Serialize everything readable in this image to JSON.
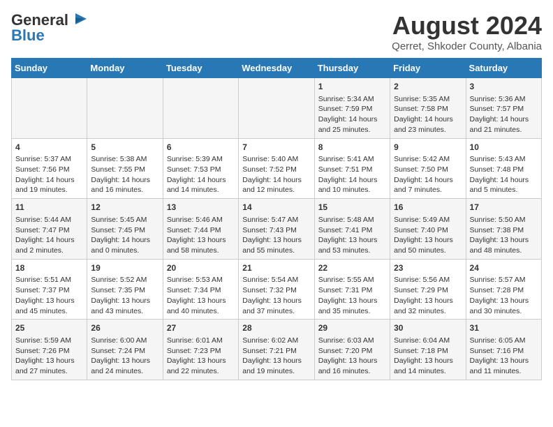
{
  "header": {
    "logo_general": "General",
    "logo_blue": "Blue",
    "month_year": "August 2024",
    "location": "Qerret, Shkoder County, Albania"
  },
  "weekdays": [
    "Sunday",
    "Monday",
    "Tuesday",
    "Wednesday",
    "Thursday",
    "Friday",
    "Saturday"
  ],
  "weeks": [
    [
      {
        "day": "",
        "info": ""
      },
      {
        "day": "",
        "info": ""
      },
      {
        "day": "",
        "info": ""
      },
      {
        "day": "",
        "info": ""
      },
      {
        "day": "1",
        "info": "Sunrise: 5:34 AM\nSunset: 7:59 PM\nDaylight: 14 hours\nand 25 minutes."
      },
      {
        "day": "2",
        "info": "Sunrise: 5:35 AM\nSunset: 7:58 PM\nDaylight: 14 hours\nand 23 minutes."
      },
      {
        "day": "3",
        "info": "Sunrise: 5:36 AM\nSunset: 7:57 PM\nDaylight: 14 hours\nand 21 minutes."
      }
    ],
    [
      {
        "day": "4",
        "info": "Sunrise: 5:37 AM\nSunset: 7:56 PM\nDaylight: 14 hours\nand 19 minutes."
      },
      {
        "day": "5",
        "info": "Sunrise: 5:38 AM\nSunset: 7:55 PM\nDaylight: 14 hours\nand 16 minutes."
      },
      {
        "day": "6",
        "info": "Sunrise: 5:39 AM\nSunset: 7:53 PM\nDaylight: 14 hours\nand 14 minutes."
      },
      {
        "day": "7",
        "info": "Sunrise: 5:40 AM\nSunset: 7:52 PM\nDaylight: 14 hours\nand 12 minutes."
      },
      {
        "day": "8",
        "info": "Sunrise: 5:41 AM\nSunset: 7:51 PM\nDaylight: 14 hours\nand 10 minutes."
      },
      {
        "day": "9",
        "info": "Sunrise: 5:42 AM\nSunset: 7:50 PM\nDaylight: 14 hours\nand 7 minutes."
      },
      {
        "day": "10",
        "info": "Sunrise: 5:43 AM\nSunset: 7:48 PM\nDaylight: 14 hours\nand 5 minutes."
      }
    ],
    [
      {
        "day": "11",
        "info": "Sunrise: 5:44 AM\nSunset: 7:47 PM\nDaylight: 14 hours\nand 2 minutes."
      },
      {
        "day": "12",
        "info": "Sunrise: 5:45 AM\nSunset: 7:45 PM\nDaylight: 14 hours\nand 0 minutes."
      },
      {
        "day": "13",
        "info": "Sunrise: 5:46 AM\nSunset: 7:44 PM\nDaylight: 13 hours\nand 58 minutes."
      },
      {
        "day": "14",
        "info": "Sunrise: 5:47 AM\nSunset: 7:43 PM\nDaylight: 13 hours\nand 55 minutes."
      },
      {
        "day": "15",
        "info": "Sunrise: 5:48 AM\nSunset: 7:41 PM\nDaylight: 13 hours\nand 53 minutes."
      },
      {
        "day": "16",
        "info": "Sunrise: 5:49 AM\nSunset: 7:40 PM\nDaylight: 13 hours\nand 50 minutes."
      },
      {
        "day": "17",
        "info": "Sunrise: 5:50 AM\nSunset: 7:38 PM\nDaylight: 13 hours\nand 48 minutes."
      }
    ],
    [
      {
        "day": "18",
        "info": "Sunrise: 5:51 AM\nSunset: 7:37 PM\nDaylight: 13 hours\nand 45 minutes."
      },
      {
        "day": "19",
        "info": "Sunrise: 5:52 AM\nSunset: 7:35 PM\nDaylight: 13 hours\nand 43 minutes."
      },
      {
        "day": "20",
        "info": "Sunrise: 5:53 AM\nSunset: 7:34 PM\nDaylight: 13 hours\nand 40 minutes."
      },
      {
        "day": "21",
        "info": "Sunrise: 5:54 AM\nSunset: 7:32 PM\nDaylight: 13 hours\nand 37 minutes."
      },
      {
        "day": "22",
        "info": "Sunrise: 5:55 AM\nSunset: 7:31 PM\nDaylight: 13 hours\nand 35 minutes."
      },
      {
        "day": "23",
        "info": "Sunrise: 5:56 AM\nSunset: 7:29 PM\nDaylight: 13 hours\nand 32 minutes."
      },
      {
        "day": "24",
        "info": "Sunrise: 5:57 AM\nSunset: 7:28 PM\nDaylight: 13 hours\nand 30 minutes."
      }
    ],
    [
      {
        "day": "25",
        "info": "Sunrise: 5:59 AM\nSunset: 7:26 PM\nDaylight: 13 hours\nand 27 minutes."
      },
      {
        "day": "26",
        "info": "Sunrise: 6:00 AM\nSunset: 7:24 PM\nDaylight: 13 hours\nand 24 minutes."
      },
      {
        "day": "27",
        "info": "Sunrise: 6:01 AM\nSunset: 7:23 PM\nDaylight: 13 hours\nand 22 minutes."
      },
      {
        "day": "28",
        "info": "Sunrise: 6:02 AM\nSunset: 7:21 PM\nDaylight: 13 hours\nand 19 minutes."
      },
      {
        "day": "29",
        "info": "Sunrise: 6:03 AM\nSunset: 7:20 PM\nDaylight: 13 hours\nand 16 minutes."
      },
      {
        "day": "30",
        "info": "Sunrise: 6:04 AM\nSunset: 7:18 PM\nDaylight: 13 hours\nand 14 minutes."
      },
      {
        "day": "31",
        "info": "Sunrise: 6:05 AM\nSunset: 7:16 PM\nDaylight: 13 hours\nand 11 minutes."
      }
    ]
  ]
}
